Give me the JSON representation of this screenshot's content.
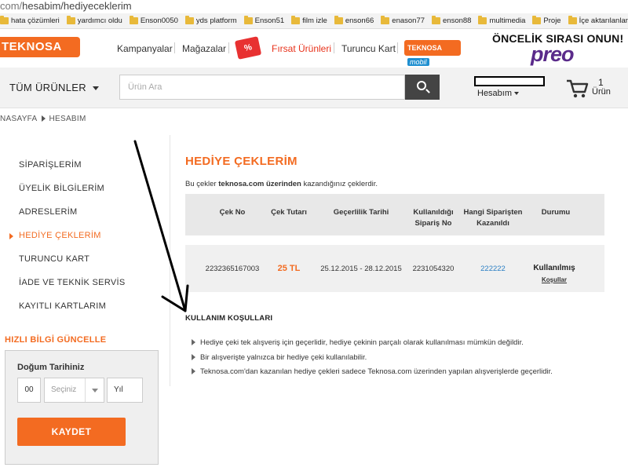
{
  "url": {
    "host": "com/",
    "path": "hesabim/hediyeceklerim"
  },
  "bookmarks": [
    "hata çözümleri",
    "yardımcı oldu",
    "Enson0050",
    "yds platform",
    "Enson51",
    "film izle",
    "enson66",
    "enason77",
    "enson88",
    "multimedia",
    "Proje",
    "İçe aktarılanlar"
  ],
  "header": {
    "logo": "TEKNOSA",
    "nav": {
      "kampanyalar": "Kampanyalar",
      "magazalar": "Mağazalar",
      "firsat": "Fırsat Ürünleri",
      "turuncu": "Turuncu Kart"
    },
    "firsat_icon": "%",
    "mobil_badge": {
      "brand": "TEKNOSA",
      "suffix": "mobil"
    },
    "promo": {
      "title": "ÖNCELİK SIRASI ONUN!",
      "brand": "preo"
    }
  },
  "searchbar": {
    "all_products": "TÜM ÜRÜNLER",
    "placeholder": "Ürün Ara",
    "account_label": "Hesabım",
    "cart_count": "1",
    "cart_label": "Ürün"
  },
  "breadcrumb": {
    "home": "NASAYFA",
    "current": "HESABIM"
  },
  "sidebar": {
    "items": [
      "SİPARİŞLERİM",
      "ÜYELİK BİLGİLERİM",
      "ADRESLERİM",
      "HEDİYE ÇEKLERİM",
      "TURUNCU KART",
      "İADE VE TEKNİK SERVİS",
      "KAYITLI KARTLARIM"
    ],
    "active_index": 3,
    "quick_update": {
      "title": "HIZLI BİLGİ GÜNCELLE",
      "dob_label": "Doğum Tarihiniz",
      "day": "00",
      "month_placeholder": "Seçiniz",
      "year": "Yıl",
      "save": "KAYDET"
    }
  },
  "main": {
    "title": "HEDİYE ÇEKLERİM",
    "desc_pre": "Bu çekler ",
    "desc_bold": "teknosa.com üzerinden",
    "desc_post": " kazandığınız çeklerdir.",
    "columns": {
      "code": "Çek No",
      "amount": "Çek Tutarı",
      "validity": "Geçerlilik Tarihi",
      "used_order_1": "Kullanıldığı",
      "used_order_2": "Sipariş No",
      "from_order_1": "Hangi Siparişten",
      "from_order_2": "Kazanıldı",
      "status": "Durumu"
    },
    "rows": [
      {
        "code": "2232365167003",
        "amount": "25 TL",
        "validity": "25.12.2015 - 28.12.2015",
        "used_order": "2231054320",
        "from_order": "222222",
        "status": "Kullanılmış",
        "conditions": "Koşullar"
      }
    ],
    "terms_title": "KULLANIM KOŞULLARI",
    "terms": [
      "Hediye çeki tek alışveriş için geçerlidir, hediye çekinin parçalı olarak kullanılması mümkün değildir.",
      "Bir alışverişte yalnızca bir hediye çeki kullanılabilir.",
      "Teknosa.com'dan kazanılan hediye çekleri sadece Teknosa.com üzerinden yapılan alışverişlerde geçerlidir."
    ]
  },
  "colors": {
    "brand_orange": "#f36b21",
    "link_blue": "#2b7fc4",
    "firsat_red": "#e8311a"
  }
}
